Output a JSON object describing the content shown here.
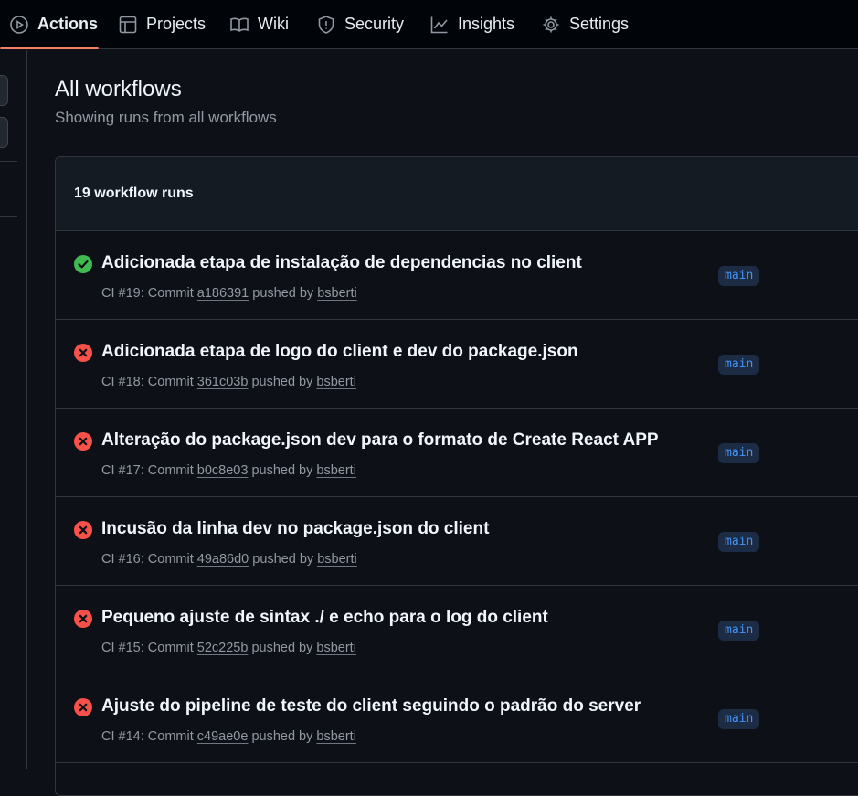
{
  "nav": {
    "tabs": [
      {
        "label": "Actions",
        "icon": "play-icon",
        "selected": true
      },
      {
        "label": "Projects",
        "icon": "table-icon"
      },
      {
        "label": "Wiki",
        "icon": "book-icon"
      },
      {
        "label": "Security",
        "icon": "shield-icon"
      },
      {
        "label": "Insights",
        "icon": "graph-icon"
      },
      {
        "label": "Settings",
        "icon": "gear-icon"
      }
    ]
  },
  "main": {
    "title": "All workflows",
    "subtitle": "Showing runs from all workflows",
    "runs_count_label": "19 workflow runs"
  },
  "runs": [
    {
      "status": "success",
      "title": "Adicionada etapa de instalação de dependencias no client",
      "prefix": "CI #19: Commit",
      "commit": "a186391",
      "pushed_by_label": "pushed by",
      "actor": "bsberti",
      "branch": "main"
    },
    {
      "status": "failure",
      "title": "Adicionada etapa de logo do client e dev do package.json",
      "prefix": "CI #18: Commit",
      "commit": "361c03b",
      "pushed_by_label": "pushed by",
      "actor": "bsberti",
      "branch": "main"
    },
    {
      "status": "failure",
      "title": "Alteração do package.json dev para o formato de Create React APP",
      "prefix": "CI #17: Commit",
      "commit": "b0c8e03",
      "pushed_by_label": "pushed by",
      "actor": "bsberti",
      "branch": "main"
    },
    {
      "status": "failure",
      "title": "Incusão da linha dev no package.json do client",
      "prefix": "CI #16: Commit",
      "commit": "49a86d0",
      "pushed_by_label": "pushed by",
      "actor": "bsberti",
      "branch": "main"
    },
    {
      "status": "failure",
      "title": "Pequeno ajuste de sintax ./ e echo para o log do client",
      "prefix": "CI #15: Commit",
      "commit": "52c225b",
      "pushed_by_label": "pushed by",
      "actor": "bsberti",
      "branch": "main"
    },
    {
      "status": "failure",
      "title": "Ajuste do pipeline de teste do client seguindo o padrão do server",
      "prefix": "CI #14: Commit",
      "commit": "c49ae0e",
      "pushed_by_label": "pushed by",
      "actor": "bsberti",
      "branch": "main"
    }
  ],
  "colors": {
    "success": "#3fb950",
    "failure": "#f85149",
    "accent_underline": "#f78166",
    "branch_text": "#4493f8"
  }
}
